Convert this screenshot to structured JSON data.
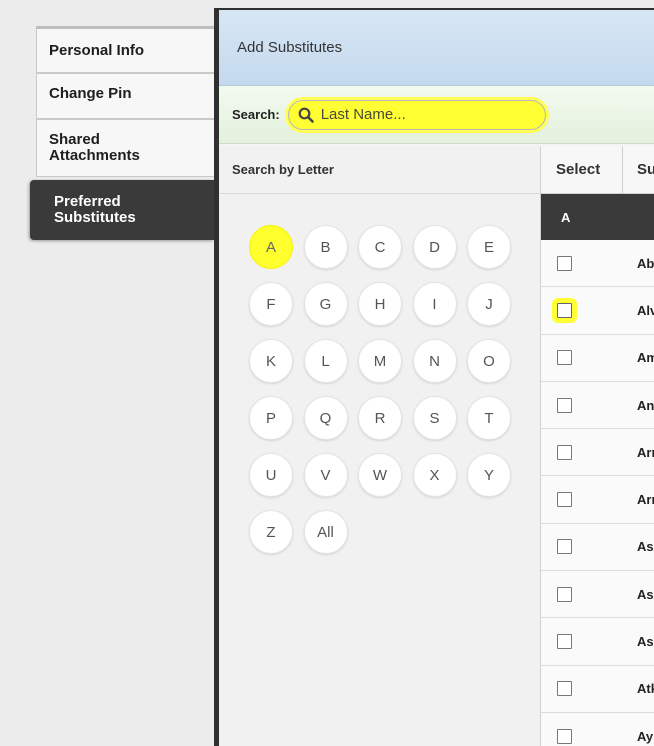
{
  "side_menu": {
    "items": [
      {
        "label": "Personal Info"
      },
      {
        "label": "Change Pin"
      },
      {
        "label": "Shared Attachments"
      },
      {
        "label": "Preferred Substitutes",
        "active": true
      }
    ]
  },
  "panel": {
    "title": "Add Substitutes",
    "search": {
      "label": "Search:",
      "placeholder": "Last Name...",
      "value": ""
    },
    "letters": {
      "header": "Search by Letter",
      "buttons": [
        "A",
        "B",
        "C",
        "D",
        "E",
        "F",
        "G",
        "H",
        "I",
        "J",
        "K",
        "L",
        "M",
        "N",
        "O",
        "P",
        "Q",
        "R",
        "S",
        "T",
        "U",
        "V",
        "W",
        "X",
        "Y",
        "Z",
        "All"
      ],
      "highlighted": "A"
    },
    "table": {
      "columns": [
        "Select",
        "Su"
      ],
      "group": "A",
      "rows": [
        {
          "name": "Abı"
        },
        {
          "name": "Alv"
        },
        {
          "name": "Am"
        },
        {
          "name": "Anı"
        },
        {
          "name": "Arr"
        },
        {
          "name": "Arr"
        },
        {
          "name": "Asl"
        },
        {
          "name": "Asl"
        },
        {
          "name": "Asp"
        },
        {
          "name": "Atk"
        },
        {
          "name": "Ayı"
        }
      ],
      "highlighted_row": 1
    }
  },
  "colors": {
    "highlight": "#ffff33",
    "active_tab": "#3a3a3a",
    "header_blue": "#c4d9ee",
    "search_green": "#e3f1dc"
  }
}
